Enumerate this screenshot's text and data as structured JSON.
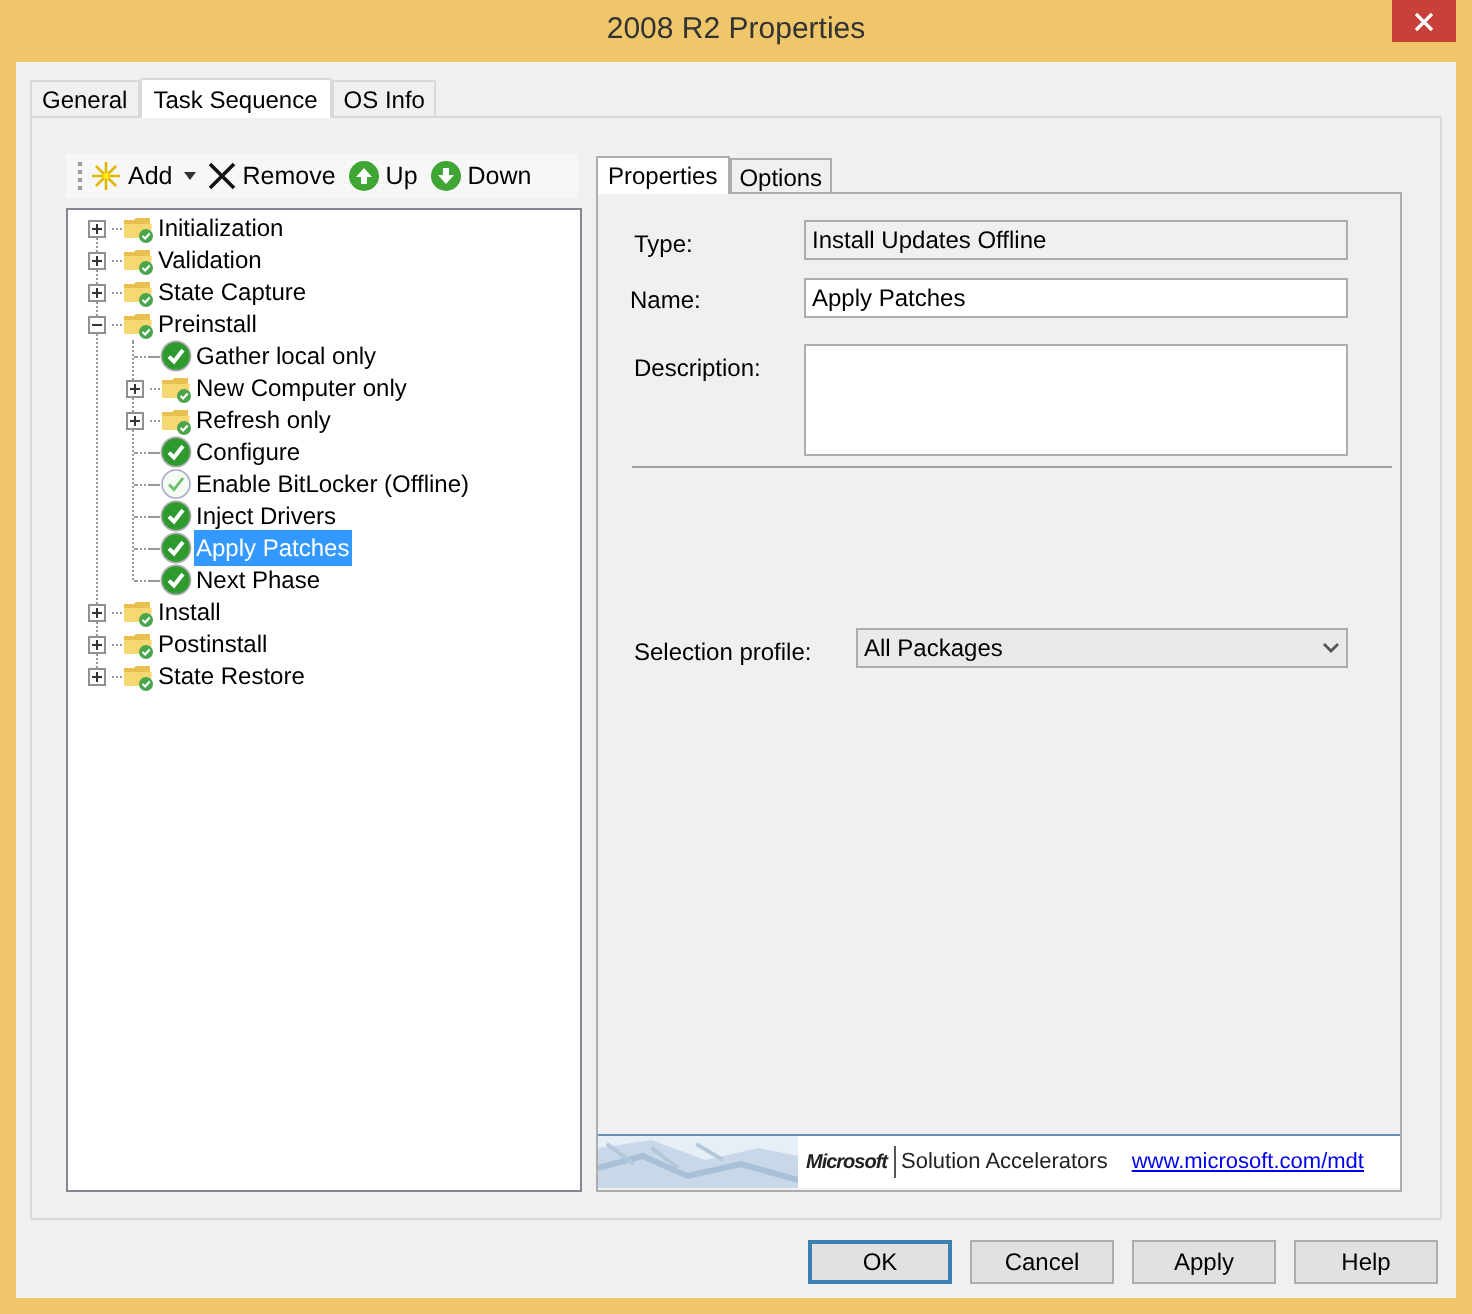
{
  "window": {
    "title": "2008 R2 Properties"
  },
  "tabs": [
    {
      "label": "General",
      "selected": false
    },
    {
      "label": "Task Sequence",
      "selected": true
    },
    {
      "label": "OS Info",
      "selected": false
    }
  ],
  "toolbar": [
    {
      "label": "Add",
      "kind": "add"
    },
    {
      "label": "Remove",
      "kind": "remove"
    },
    {
      "label": "Up",
      "kind": "up"
    },
    {
      "label": "Down",
      "kind": "down"
    }
  ],
  "tree": [
    {
      "label": "Initialization",
      "kind": "group",
      "expanded": false,
      "selected": false
    },
    {
      "label": "Validation",
      "kind": "group",
      "expanded": false,
      "selected": false
    },
    {
      "label": "State Capture",
      "kind": "group",
      "expanded": false,
      "selected": false
    },
    {
      "label": "Preinstall",
      "kind": "group",
      "expanded": true,
      "selected": false,
      "children": [
        {
          "label": "Gather local only",
          "kind": "step",
          "enabled": true,
          "selected": false
        },
        {
          "label": "New Computer only",
          "kind": "group",
          "expanded": false,
          "selected": false
        },
        {
          "label": "Refresh only",
          "kind": "group",
          "expanded": false,
          "selected": false
        },
        {
          "label": "Configure",
          "kind": "step",
          "enabled": true,
          "selected": false
        },
        {
          "label": "Enable BitLocker (Offline)",
          "kind": "step",
          "enabled": false,
          "selected": false
        },
        {
          "label": "Inject Drivers",
          "kind": "step",
          "enabled": true,
          "selected": false
        },
        {
          "label": "Apply Patches",
          "kind": "step",
          "enabled": true,
          "selected": true
        },
        {
          "label": "Next Phase",
          "kind": "step",
          "enabled": true,
          "selected": false
        }
      ]
    },
    {
      "label": "Install",
      "kind": "group",
      "expanded": false,
      "selected": false
    },
    {
      "label": "Postinstall",
      "kind": "group",
      "expanded": false,
      "selected": false
    },
    {
      "label": "State Restore",
      "kind": "group",
      "expanded": false,
      "selected": false
    }
  ],
  "detail_tabs": [
    {
      "label": "Properties",
      "selected": true
    },
    {
      "label": "Options",
      "selected": false
    }
  ],
  "fields": {
    "type": {
      "label": "Type:",
      "value": "Install Updates Offline"
    },
    "name": {
      "label": "Name:",
      "value": "Apply Patches"
    },
    "description": {
      "label": "Description:"
    },
    "selection_profile": {
      "label": "Selection profile:",
      "value": "All Packages"
    }
  },
  "banner": {
    "logo": "Microsoft",
    "product": "Solution Accelerators",
    "link": "www.microsoft.com/mdt"
  },
  "buttons": [
    {
      "label": "OK",
      "default": true
    },
    {
      "label": "Cancel",
      "default": false
    },
    {
      "label": "Apply",
      "default": false
    },
    {
      "label": "Help",
      "default": false
    }
  ]
}
